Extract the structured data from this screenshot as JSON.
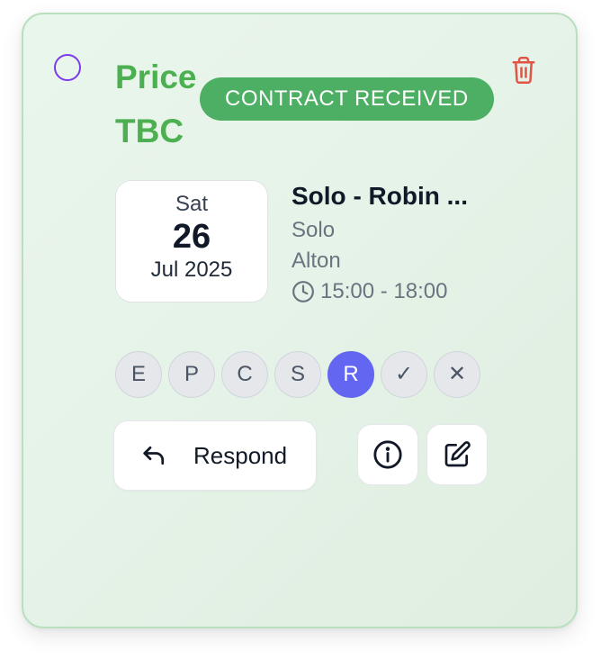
{
  "card": {
    "price_text": "Price TBC",
    "status_badge": "CONTRACT RECEIVED",
    "status_color": "#4caf63",
    "accent_color": "#4caf50",
    "delete_icon": "trash-icon",
    "select_icon": "circle-outline-icon"
  },
  "date": {
    "day_of_week": "Sat",
    "day": "26",
    "month_year": "Jul 2025"
  },
  "event": {
    "title": "Solo - Robin ...",
    "type": "Solo",
    "location": "Alton",
    "time": "15:00 - 18:00",
    "time_icon": "clock-icon"
  },
  "stages": [
    {
      "label": "E",
      "active": false
    },
    {
      "label": "P",
      "active": false
    },
    {
      "label": "C",
      "active": false
    },
    {
      "label": "S",
      "active": false
    },
    {
      "label": "R",
      "active": true
    },
    {
      "label": "✓",
      "active": false
    },
    {
      "label": "✕",
      "active": false
    }
  ],
  "actions": {
    "respond_label": "Respond",
    "respond_icon": "reply-arrow-icon",
    "info_icon": "info-icon",
    "edit_icon": "edit-icon"
  }
}
